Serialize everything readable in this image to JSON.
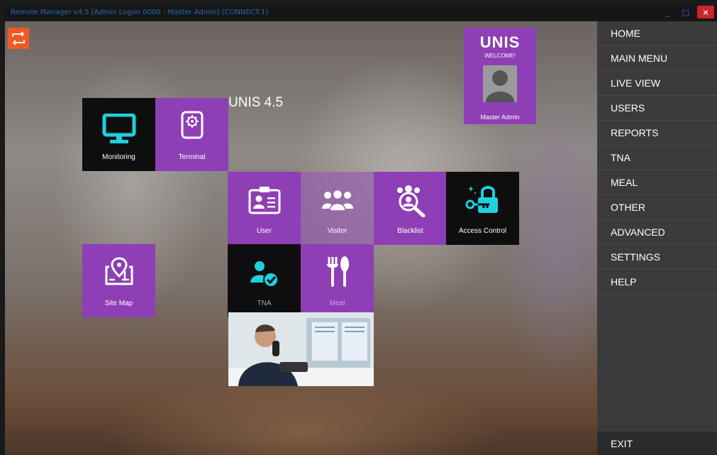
{
  "window": {
    "title": "Remote Manager v4.5 [Admin Logon 0000 : Master Admin] (CONNECT:1)",
    "controls": {
      "minimize": "_",
      "maximize": "□",
      "close": "×"
    }
  },
  "app": {
    "heading": "UNIS 4.5"
  },
  "welcome": {
    "logo": "UNIS",
    "subtitle": "WELCOME!",
    "user_name": "Master Admin"
  },
  "tiles": {
    "monitoring": "Monitoring",
    "terminal": "Terminal",
    "user": "User",
    "visitor": "Visitor",
    "blacklist": "Blacklist",
    "access_control": "Access Control",
    "site_map": "Site Map",
    "tna": "TNA",
    "meal": "Meal"
  },
  "sidebar": {
    "items": [
      "HOME",
      "MAIN MENU",
      "LIVE VIEW",
      "USERS",
      "REPORTS",
      "TNA",
      "MEAL",
      "OTHER",
      "ADVANCED",
      "SETTINGS",
      "HELP"
    ],
    "exit": "EXIT"
  },
  "colors": {
    "accent_purple": "#8e3fb5",
    "tile_black": "#0e0e0e",
    "swap_orange": "#f05a22",
    "monitor_cyan": "#1fd0e0",
    "sidebar_bg": "#3b3b3b"
  }
}
